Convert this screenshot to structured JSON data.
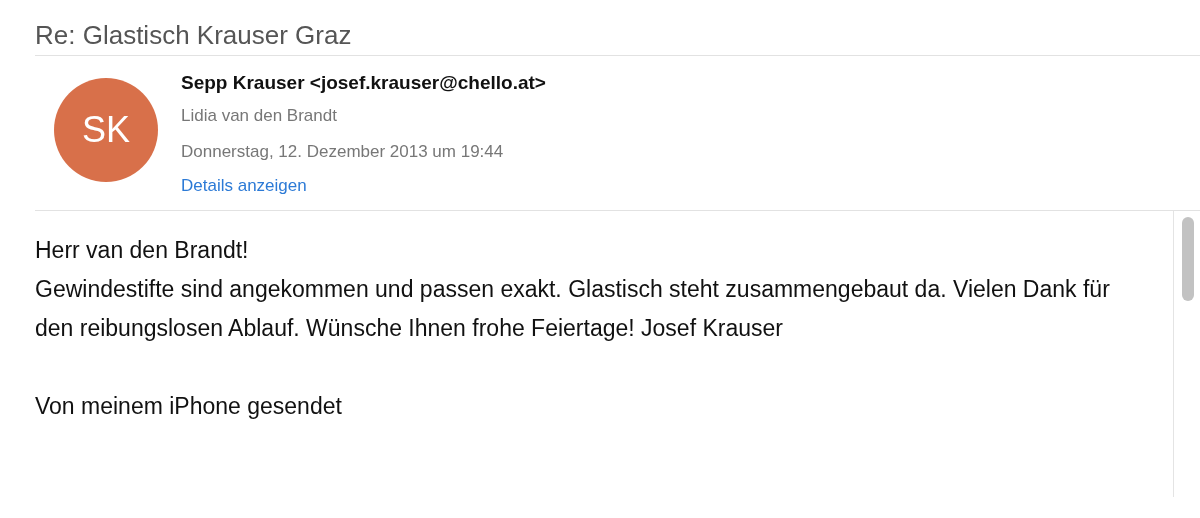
{
  "subject": "Re: Glastisch Krauser Graz",
  "header": {
    "avatar_initials": "SK",
    "sender": "Sepp Krauser <josef.krauser@chello.at>",
    "recipient": "Lidia van den Brandt",
    "date": "Donnerstag, 12. Dezember 2013 um 19:44",
    "details_link": "Details anzeigen"
  },
  "body": [
    "Herr van den Brandt!\nGewindestifte sind angekommen und passen exakt. Glastisch steht zusammengebaut da. Vielen Dank für den reibungslosen Ablauf. Wünsche Ihnen frohe Feiertage! Josef Krauser",
    "Von meinem iPhone gesendet"
  ]
}
